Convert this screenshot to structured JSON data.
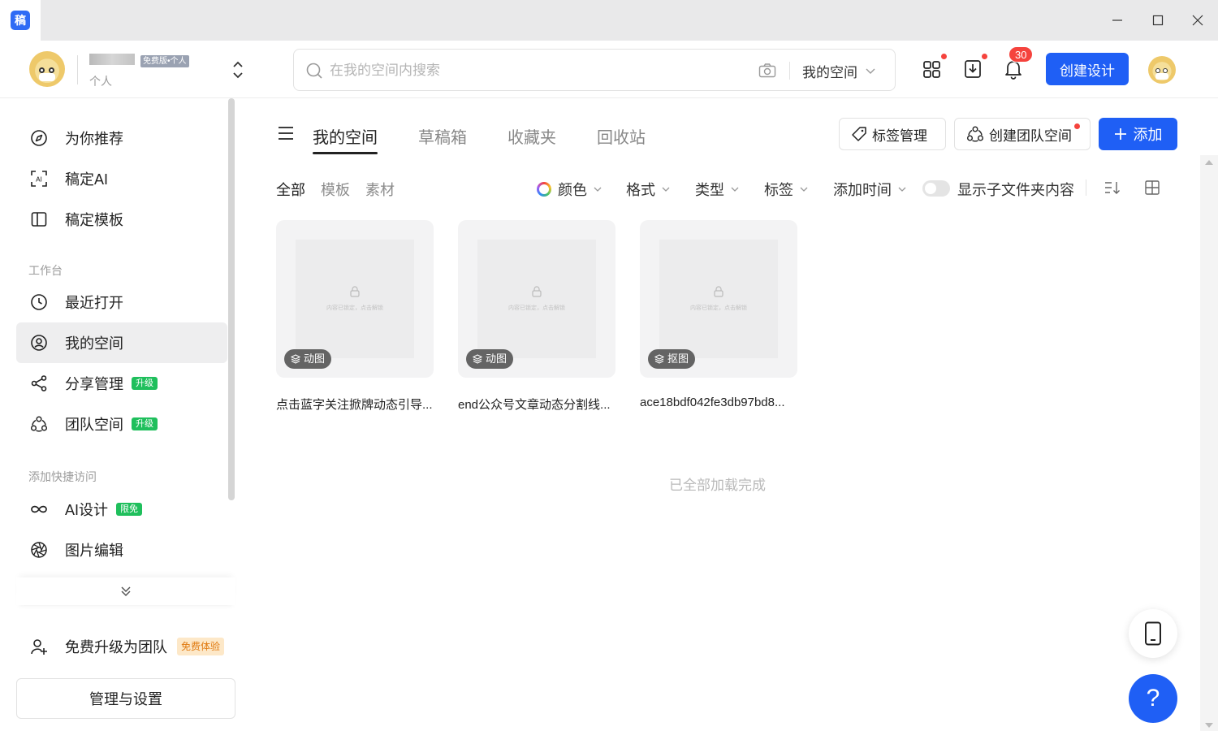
{
  "window": {
    "app_icon_char": "稿",
    "controls": [
      "minimize",
      "maximize",
      "close"
    ]
  },
  "header": {
    "plan_badge": "免费版•个人",
    "user_sub": "个人",
    "search": {
      "placeholder": "在我的空间内搜索",
      "scope": "我的空间"
    },
    "notification_count": "30",
    "create_button": "创建设计"
  },
  "sidebar": {
    "top_items": [
      {
        "label": "为你推荐",
        "icon": "compass-icon"
      },
      {
        "label": "稿定AI",
        "icon": "ai-icon"
      },
      {
        "label": "稿定模板",
        "icon": "template-icon"
      }
    ],
    "workbench_title": "工作台",
    "workbench_items": [
      {
        "label": "最近打开",
        "icon": "clock-icon",
        "tag": ""
      },
      {
        "label": "我的空间",
        "icon": "user-circle-icon",
        "tag": ""
      },
      {
        "label": "分享管理",
        "icon": "share-icon",
        "tag": "升级"
      },
      {
        "label": "团队空间",
        "icon": "team-icon",
        "tag": "升级"
      }
    ],
    "quick_title": "添加快捷访问",
    "quick_items": [
      {
        "label": "AI设计",
        "icon": "infinity-icon",
        "tag": "限免"
      },
      {
        "label": "图片编辑",
        "icon": "aperture-icon",
        "tag": ""
      }
    ],
    "upgrade": {
      "label": "免费升级为团队",
      "tag": "免费体验"
    },
    "manage_button": "管理与设置"
  },
  "main": {
    "tabs": [
      "我的空间",
      "草稿箱",
      "收藏夹",
      "回收站"
    ],
    "active_tab": 0,
    "tag_manage": "标签管理",
    "create_team": "创建团队空间",
    "add_button": "添加",
    "subtabs": [
      "全部",
      "模板",
      "素材"
    ],
    "filters": {
      "color": "颜色",
      "format": "格式",
      "type": "类型",
      "tag": "标签",
      "time": "添加时间"
    },
    "show_subfolder": "显示子文件夹内容",
    "cards": [
      {
        "type": "动图",
        "name": "点击蓝字关注掀牌动态引导...",
        "lock_text": "内容已锁定，点击解锁"
      },
      {
        "type": "动图",
        "name": "end公众号文章动态分割线...",
        "lock_text": "内容已锁定，点击解锁"
      },
      {
        "type": "抠图",
        "name": "ace18bdf042fe3db97bd8...",
        "lock_text": "内容已锁定，点击解锁"
      }
    ],
    "all_loaded": "已全部加载完成"
  },
  "floating": {
    "help": "?"
  },
  "colors": {
    "primary": "#1f5ff5",
    "badge_red": "#f5433d",
    "tag_green": "#1fbf5c"
  }
}
